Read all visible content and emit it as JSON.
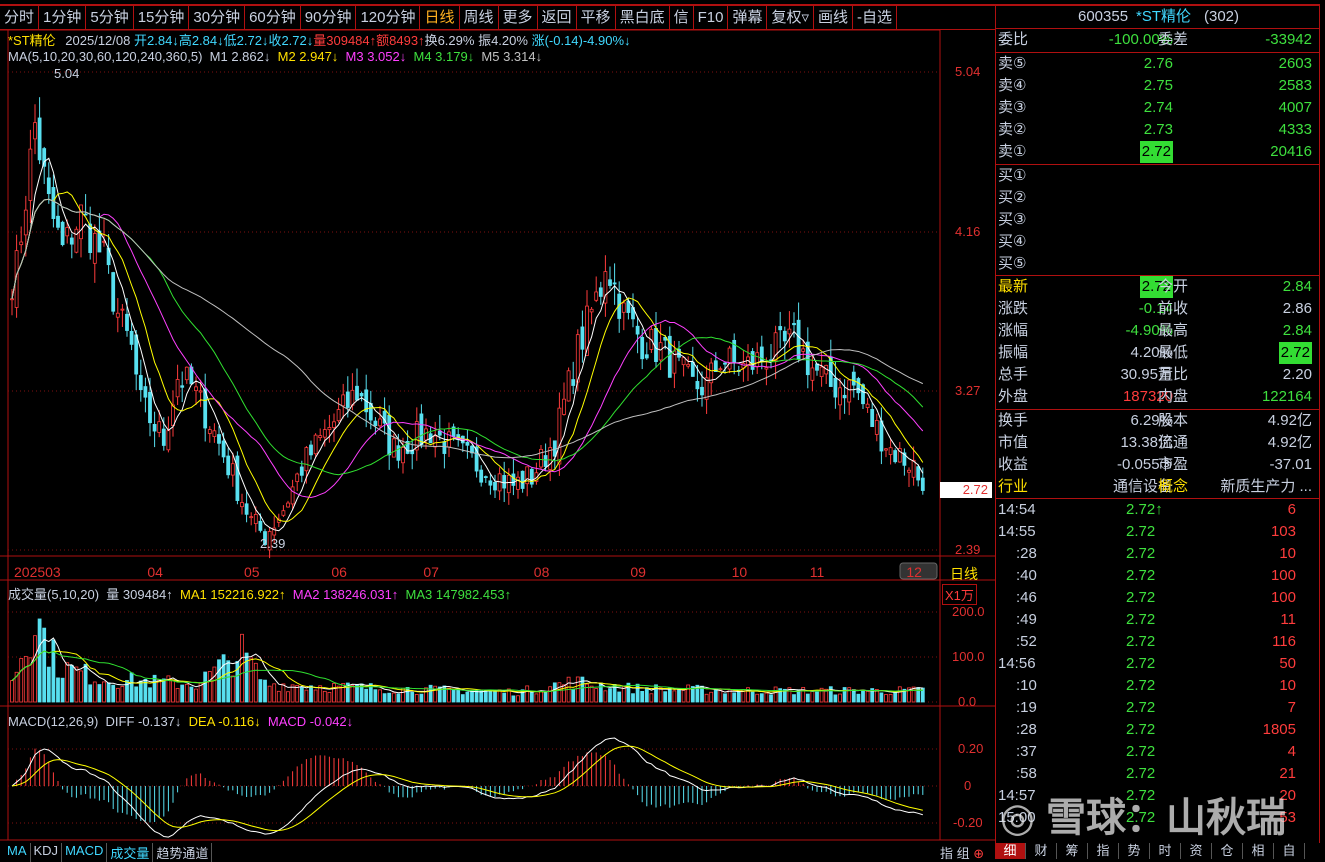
{
  "toolbar": [
    "分时",
    "1分钟",
    "5分钟",
    "15分钟",
    "30分钟",
    "60分钟",
    "90分钟",
    "120分钟",
    "日线",
    "周线",
    "更多",
    "返回",
    "平移",
    "黑白底",
    "信",
    "F10",
    "弹幕",
    "复权▿",
    "画线",
    "-自选"
  ],
  "toolbar_active": "日线",
  "info": {
    "name": "*ST精伦",
    "date": "2025/12/08",
    "open": "开2.84↓",
    "high": "高2.84↓",
    "low": "低2.72↓",
    "close": "收2.72↓",
    "vol": "量309484↑",
    "amt": "额8493↑",
    "turn": "换6.29%",
    "amp": "振4.20%",
    "chg": "涨(-0.14)-4.90%↓"
  },
  "ma_line": {
    "label": "MA(5,10,20,30,60,120,240,360,5)",
    "m1": "M1 2.862↓",
    "m2": "M2 2.947↓",
    "m3": "M3 3.052↓",
    "m4": "M4 3.179↓",
    "m5": "M5 3.314↓"
  },
  "price_axis": [
    "5.04",
    "4.16",
    "3.27",
    "2.39"
  ],
  "last_price": "2.72",
  "high_mark": "5.04",
  "low_mark": "2.39",
  "period_label": "日线",
  "month_ticks": [
    {
      "label": "202503",
      "day": 0
    },
    {
      "label": "04",
      "day": 29
    },
    {
      "label": "05",
      "day": 50
    },
    {
      "label": "06",
      "day": 69
    },
    {
      "label": "07",
      "day": 89
    },
    {
      "label": "08",
      "day": 113
    },
    {
      "label": "09",
      "day": 134
    },
    {
      "label": "10",
      "day": 156
    },
    {
      "label": "11",
      "day": 173
    },
    {
      "label": "12",
      "day": 194
    }
  ],
  "volume": {
    "title": "成交量(5,10,20)",
    "v": "量 309484↑",
    "ma1": "MA1 152216.922↑",
    "ma2": "MA2 138246.031↑",
    "ma3": "MA3 147982.453↑",
    "unit": "X1万",
    "axis": [
      "200.0",
      "100.0",
      "0.0"
    ]
  },
  "macd": {
    "title": "MACD(12,26,9)",
    "diff": "DIFF -0.137↓",
    "dea": "DEA -0.116↓",
    "macd": "MACD -0.042↓",
    "axis": [
      "0.20",
      "0",
      "-0.20"
    ]
  },
  "bottom_tabs": [
    "MA",
    "KDJ",
    "MACD",
    "成交量",
    "趋势通道"
  ],
  "bottom_right": [
    "指",
    "组"
  ],
  "colors": {
    "up": "#ff3c3c",
    "down": "#58e0f0",
    "ma1": "#ffffff",
    "ma2": "#ffff00",
    "ma3": "#ff40ff",
    "ma4": "#30e030",
    "ma5": "#c0c0c0"
  },
  "chart_data": {
    "type": "candlestick",
    "price_keyframes": [
      [
        0,
        3.9
      ],
      [
        1,
        3.95
      ],
      [
        5,
        4.75
      ],
      [
        8,
        4.3
      ],
      [
        11,
        4.05
      ],
      [
        15,
        4.25
      ],
      [
        20,
        4.0
      ],
      [
        23,
        3.7
      ],
      [
        26,
        3.5
      ],
      [
        28,
        3.2
      ],
      [
        33,
        3.0
      ],
      [
        36,
        3.35
      ],
      [
        39,
        3.3
      ],
      [
        43,
        3.1
      ],
      [
        48,
        2.8
      ],
      [
        52,
        2.55
      ],
      [
        55,
        2.47
      ],
      [
        59,
        2.62
      ],
      [
        63,
        2.85
      ],
      [
        67,
        3.0
      ],
      [
        73,
        3.2
      ],
      [
        75,
        3.27
      ],
      [
        79,
        3.1
      ],
      [
        83,
        2.95
      ],
      [
        87,
        3.0
      ],
      [
        91,
        3.05
      ],
      [
        96,
        2.95
      ],
      [
        102,
        2.85
      ],
      [
        109,
        2.75
      ],
      [
        113,
        2.8
      ],
      [
        118,
        3.0
      ],
      [
        123,
        3.5
      ],
      [
        128,
        3.85
      ],
      [
        129,
        4.0
      ],
      [
        133,
        3.7
      ],
      [
        137,
        3.55
      ],
      [
        141,
        3.5
      ],
      [
        148,
        3.3
      ],
      [
        151,
        3.3
      ],
      [
        154,
        3.45
      ],
      [
        159,
        3.4
      ],
      [
        163,
        3.45
      ],
      [
        170,
        3.55
      ],
      [
        174,
        3.4
      ],
      [
        178,
        3.3
      ],
      [
        183,
        3.3
      ],
      [
        187,
        3.1
      ],
      [
        191,
        2.95
      ],
      [
        196,
        2.86
      ],
      [
        198,
        2.72
      ]
    ],
    "volume_keyframes": [
      [
        0,
        50
      ],
      [
        5,
        190
      ],
      [
        10,
        80
      ],
      [
        20,
        50
      ],
      [
        40,
        40
      ],
      [
        50,
        110
      ],
      [
        55,
        40
      ],
      [
        80,
        30
      ],
      [
        110,
        22
      ],
      [
        122,
        45
      ],
      [
        135,
        30
      ],
      [
        160,
        25
      ],
      [
        197,
        25
      ],
      [
        198,
        31
      ]
    ],
    "ylim": [
      2.39,
      5.04
    ]
  },
  "panel": {
    "title_code": "600355",
    "title_name": "*ST精伦",
    "title_num": "(302)",
    "weibi": [
      "委比",
      "-100.00%",
      "委差",
      "-33942"
    ],
    "sells": [
      [
        "卖⑤",
        "2.76",
        "2603"
      ],
      [
        "卖④",
        "2.75",
        "2583"
      ],
      [
        "卖③",
        "2.74",
        "4007"
      ],
      [
        "卖②",
        "2.73",
        "4333"
      ],
      [
        "卖①",
        "2.72",
        "20416"
      ]
    ],
    "buys": [
      "买①",
      "买②",
      "买③",
      "买④",
      "买⑤"
    ],
    "quote": [
      [
        "最新",
        "2.72",
        "今开",
        "2.84"
      ],
      [
        "涨跌",
        "-0.14",
        "前收",
        "2.86"
      ],
      [
        "涨幅",
        "-4.90%",
        "最高",
        "2.84"
      ],
      [
        "振幅",
        "4.20%",
        "最低",
        "2.72"
      ],
      [
        "总手",
        "30.95万",
        "量比",
        "2.20"
      ],
      [
        "外盘",
        "187320",
        "内盘",
        "122164"
      ]
    ],
    "fund": [
      [
        "换手",
        "6.29%",
        "股本",
        "4.92亿"
      ],
      [
        "市值",
        "13.38亿",
        "流通",
        "4.92亿"
      ],
      [
        "收益",
        "-0.055③",
        "市盈",
        "-37.01"
      ],
      [
        "行业",
        "通信设备",
        "概念",
        "新质生产力 ..."
      ]
    ],
    "ticks": [
      [
        "14:54",
        "2.72↑",
        "6"
      ],
      [
        "14:55",
        "2.72",
        "103"
      ],
      [
        ":28",
        "2.72",
        "10"
      ],
      [
        ":40",
        "2.72",
        "100"
      ],
      [
        ":46",
        "2.72",
        "100"
      ],
      [
        ":49",
        "2.72",
        "11"
      ],
      [
        ":52",
        "2.72",
        "116"
      ],
      [
        "14:56",
        "2.72",
        "50"
      ],
      [
        ":10",
        "2.72",
        "10"
      ],
      [
        ":19",
        "2.72",
        "7"
      ],
      [
        ":28",
        "2.72",
        "1805"
      ],
      [
        ":37",
        "2.72",
        "4"
      ],
      [
        ":58",
        "2.72",
        "21"
      ],
      [
        "14:57",
        "2.72",
        "20"
      ],
      [
        "15:00",
        "2.72",
        "53"
      ]
    ],
    "tabs": [
      "细",
      "财",
      "筹",
      "指",
      "势",
      "时",
      "资",
      "仓",
      "相",
      "自"
    ]
  },
  "watermark": "雪球：山秋瑞"
}
